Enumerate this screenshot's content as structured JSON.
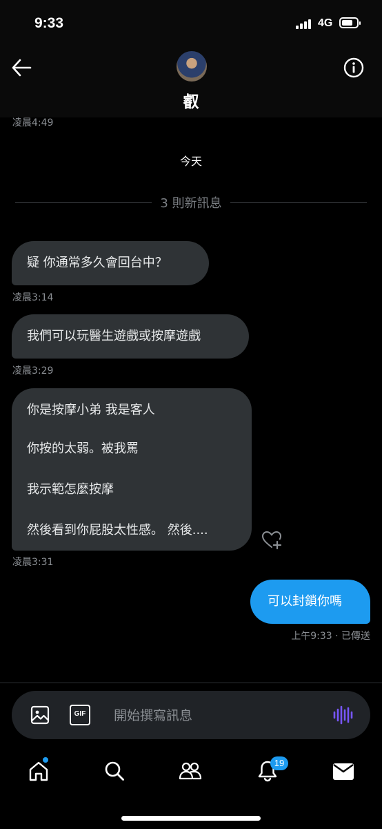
{
  "status_bar": {
    "time": "9:33",
    "network": "4G"
  },
  "header": {
    "contact_name": "叡"
  },
  "conversation": {
    "top_timestamp": "凌晨4:49",
    "date_separator": "今天",
    "new_messages_label": "3 則新訊息",
    "messages": [
      {
        "direction": "incoming",
        "lines": [
          "疑 你通常多久會回台中？"
        ],
        "timestamp": "凌晨3:14"
      },
      {
        "direction": "incoming",
        "lines": [
          "我們可以玩醫生遊戲或按摩遊戲"
        ],
        "timestamp": "凌晨3:29"
      },
      {
        "direction": "incoming",
        "lines": [
          "你是按摩小弟 我是客人",
          "你按的太弱。被我罵",
          "我示範怎麼按摩",
          "然後看到你屁股太性感。 然後...."
        ],
        "timestamp": "凌晨3:31"
      },
      {
        "direction": "outgoing",
        "lines": [
          "可以封鎖你嗎"
        ],
        "timestamp": "上午9:33 · 已傳送"
      }
    ]
  },
  "composer": {
    "gif_label": "GIF",
    "placeholder": "開始撰寫訊息"
  },
  "tab_bar": {
    "notifications_badge": "19"
  },
  "colors": {
    "accent": "#1d9bf0",
    "bubble_incoming": "#2f3336",
    "voice": "#7856ff"
  }
}
